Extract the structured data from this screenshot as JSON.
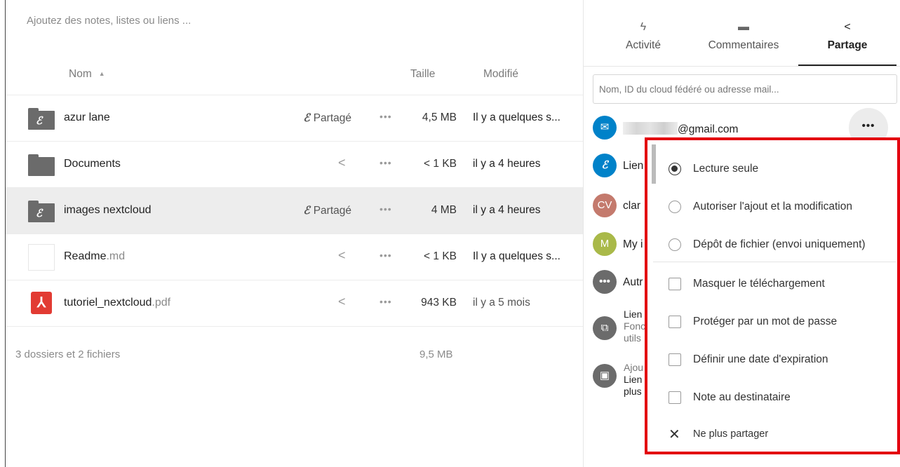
{
  "files": {
    "note_placeholder": "Ajoutez des notes, listes ou liens ...",
    "columns": {
      "name": "Nom",
      "size": "Taille",
      "modified": "Modifié"
    },
    "rows": [
      {
        "name": "azur lane",
        "ext": "",
        "type": "shared-folder",
        "share": "Partagé",
        "size": "4,5 MB",
        "modified": "Il y a quelques s..."
      },
      {
        "name": "Documents",
        "ext": "",
        "type": "folder",
        "share": "",
        "size": "< 1 KB",
        "modified": "il y a 4 heures"
      },
      {
        "name": "images nextcloud",
        "ext": "",
        "type": "shared-folder",
        "share": "Partagé",
        "size": "4 MB",
        "modified": "il y a 4 heures"
      },
      {
        "name": "Readme",
        "ext": ".md",
        "type": "file",
        "share": "",
        "size": "< 1 KB",
        "modified": "Il y a quelques s..."
      },
      {
        "name": "tutoriel_nextcloud",
        "ext": ".pdf",
        "type": "pdf",
        "share": "",
        "size": "943 KB",
        "modified": "il y a 5 mois"
      }
    ],
    "summary": "3 dossiers et 2 fichiers",
    "summary_size": "9,5 MB"
  },
  "sidebar": {
    "tabs": [
      {
        "label": "Activité",
        "icon": "lightning-icon"
      },
      {
        "label": "Commentaires",
        "icon": "comment-icon"
      },
      {
        "label": "Partage",
        "icon": "share-icon",
        "active": true
      }
    ],
    "share_placeholder": "Nom, ID du cloud fédéré ou adresse mail...",
    "shares": {
      "email_suffix": "@gmail.com",
      "link": "Lien",
      "user1_initials": "CV",
      "user1_name": "clar",
      "user2_initials": "M",
      "user2_name": "My i",
      "others": "Autr",
      "other_link_title": "Lien",
      "other_link_line2": "Fonc",
      "other_link_line3": "utils",
      "add_line1": "Ajou",
      "add_line2": "Lien",
      "add_line3": "plus"
    },
    "menu": {
      "permissions": [
        {
          "label": "Lecture seule",
          "checked": true
        },
        {
          "label": "Autoriser l'ajout et la modification",
          "checked": false
        },
        {
          "label": "Dépôt de fichier (envoi uniquement)",
          "checked": false
        }
      ],
      "options": [
        "Masquer le téléchargement",
        "Protéger par un mot de passe",
        "Définir une date d'expiration",
        "Note au destinataire"
      ],
      "unshare": "Ne plus partager"
    },
    "colors": {
      "accent": "#0082c9",
      "highlight": "#e3000f"
    }
  }
}
